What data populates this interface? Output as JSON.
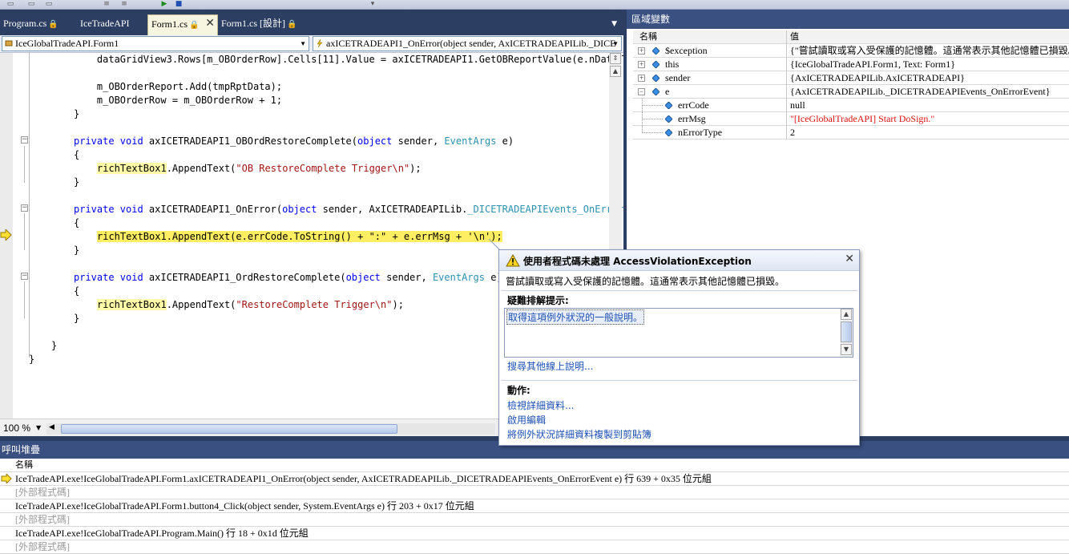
{
  "doc_tabs": [
    {
      "label": "Program.cs",
      "locked": true
    },
    {
      "label": "IceTradeAPI",
      "locked": false
    },
    {
      "label": "Form1.cs",
      "locked": true,
      "active": true
    },
    {
      "label": "Form1.cs [設計]",
      "locked": true
    }
  ],
  "nav": {
    "class_dropdown": "IceGlobalTradeAPI.Form1",
    "member_dropdown": "axICETRADEAPI1_OnError(object sender, AxICETRADEAPILib._DICE"
  },
  "code": {
    "l1": "    dataGridView3.Rows[m_OBOrderRow].Cells[11].Value = axICETRADEAPI1.GetOBReportValue(e.nDataT",
    "l2": "    m_OBOrderReport.Add(tmpRptData);",
    "l3": "    m_OBOrderRow = m_OBOrderRow + 1;",
    "l4": "}",
    "m1_kw": "private void ",
    "m1_name": "axICETRADEAPI1_OBOrdRestoreComplete(",
    "m1_obj": "object",
    "m1_mid": " sender, ",
    "m1_type": "EventArgs",
    "m1_end": " e)",
    "brace_open": "{",
    "brace_close": "}",
    "m1_body_obj": "richTextBox1",
    "m1_body_call": ".AppendText(",
    "m1_body_str": "\"OB RestoreComplete Trigger\\n\"",
    "m1_body_end": ");",
    "m2_name": "axICETRADEAPI1_OnError(",
    "m2_mid": " sender, AxICETRADEAPILib.",
    "m2_type": "_DICETRADEAPIEvents_OnErrorE",
    "m2_body_obj": "richTextBox1",
    "m2_body_rest": ".AppendText(e.errCode.ToString() + \":\" + e.errMsg + '\\n');",
    "m3_name": "axICETRADEAPI1_OrdRestoreComplete(",
    "m3_body_str": "\"RestoreComplete Trigger\\n\"",
    "class_close": "}",
    "ns_close": "}"
  },
  "zoom": "100 %",
  "locals": {
    "title": "區域變數",
    "col_name": "名稱",
    "col_value": "值",
    "rows": [
      {
        "name": "$exception",
        "value": "{\"嘗試讀取或寫入受保護的記憶體。這通常表示其他記憶體已損毀。\"}"
      },
      {
        "name": "this",
        "value": "{IceGlobalTradeAPI.Form1, Text: Form1}"
      },
      {
        "name": "sender",
        "value": "{AxICETRADEAPILib.AxICETRADEAPI}"
      },
      {
        "name": "e",
        "value": "{AxICETRADEAPILib._DICETRADEAPIEvents_OnErrorEvent}"
      },
      {
        "name": "errCode",
        "value": "null"
      },
      {
        "name": "errMsg",
        "value": "\"[IceGlobalTradeAPI] Start DoSign.\""
      },
      {
        "name": "nErrorType",
        "value": "2"
      }
    ]
  },
  "callstack": {
    "title": "呼叫堆疊",
    "col_name": "名稱",
    "rows": [
      "IceTradeAPI.exe!IceGlobalTradeAPI.Form1.axICETRADEAPI1_OnError(object sender, AxICETRADEAPILib._DICETRADEAPIEvents_OnErrorEvent e) 行 639 + 0x35 位元組",
      "[外部程式碼]",
      "IceTradeAPI.exe!IceGlobalTradeAPI.Form1.button4_Click(object sender, System.EventArgs e) 行 203 + 0x17 位元組",
      "[外部程式碼]",
      "IceTradeAPI.exe!IceGlobalTradeAPI.Program.Main() 行 18 + 0x1d 位元組",
      "[外部程式碼]"
    ]
  },
  "exception": {
    "title": "使用者程式碼未處理 AccessViolationException",
    "message": "嘗試讀取或寫入受保護的記憶體。這通常表示其他記憶體已損毀。",
    "tips_label": "疑難排解提示:",
    "tip_item": "取得這項例外狀況的一般說明。",
    "search_link": "搜尋其他線上說明...",
    "actions_label": "動作:",
    "actions": [
      "檢視詳細資料...",
      "啟用編輯",
      "將例外狀況詳細資料複製到剪貼簿"
    ]
  },
  "colors": {
    "keyword": "#0000ff",
    "type": "#2b91af",
    "string": "#a31515",
    "current_line": "#ffee62",
    "pane_title": "#3a5080"
  }
}
